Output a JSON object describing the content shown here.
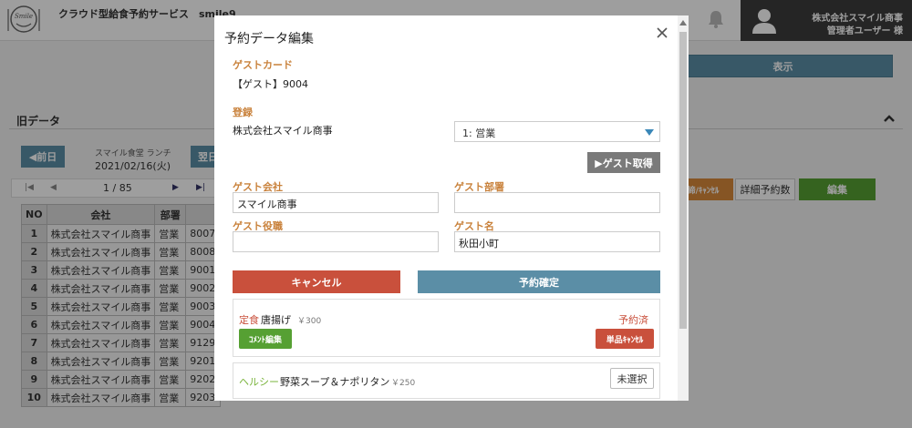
{
  "header": {
    "app_title": "クラウド型給食予約サービス　smile9",
    "user_company": "株式会社スマイル商事",
    "user_role": "管理者ユーザー 様"
  },
  "background": {
    "show_button": "表示",
    "section_title": "旧データ",
    "prev_button": "◀前日",
    "meal_name": "スマイル食堂 ランチ",
    "meal_date": "2021/02/16(火)",
    "next_button": "翌日",
    "pager_text": "1 / 85",
    "cancel_header_button": "締/ｷｬﾝｾﾙ",
    "detail_button": "詳細予約数",
    "edit_button": "編集",
    "table": {
      "headers": [
        "NO",
        "会社",
        "部署",
        ""
      ],
      "rows": [
        [
          "1",
          "株式会社スマイル商事",
          "営業",
          "8007"
        ],
        [
          "2",
          "株式会社スマイル商事",
          "営業",
          "8008"
        ],
        [
          "3",
          "株式会社スマイル商事",
          "営業",
          "9001"
        ],
        [
          "4",
          "株式会社スマイル商事",
          "営業",
          "9002"
        ],
        [
          "5",
          "株式会社スマイル商事",
          "営業",
          "9003"
        ],
        [
          "6",
          "株式会社スマイル商事",
          "営業",
          "9004"
        ],
        [
          "7",
          "株式会社スマイル商事",
          "営業",
          "9129"
        ],
        [
          "8",
          "株式会社スマイル商事",
          "営業",
          "9201"
        ],
        [
          "9",
          "株式会社スマイル商事",
          "営業",
          "9202"
        ],
        [
          "10",
          "株式会社スマイル商事",
          "営業",
          "9203"
        ]
      ]
    }
  },
  "modal": {
    "title": "予約データ編集",
    "guest_card_label": "ゲストカード",
    "guest_card_value": "【ゲスト】9004",
    "register_label": "登録",
    "register_company": "株式会社スマイル商事",
    "department_select": "1: 営業",
    "guest_get_button": "▶ゲスト取得",
    "guest_company_label": "ゲスト会社",
    "guest_company_value": "スマイル商事",
    "guest_dept_label": "ゲスト部署",
    "guest_dept_value": "",
    "guest_position_label": "ゲスト役職",
    "guest_position_value": "",
    "guest_name_label": "ゲスト名",
    "guest_name_value": "秋田小町",
    "cancel_button": "キャンセル",
    "confirm_button": "予約確定",
    "menus": [
      {
        "category": "定食",
        "category_color": "#c9503c",
        "name": "唐揚げ",
        "price": "￥300",
        "status": "予約済",
        "comment_button": "ｺﾒﾝﾄ編集",
        "cancel_button": "単品ｷｬﾝｾﾙ"
      },
      {
        "category": "ヘルシー",
        "category_color": "#7ab43c",
        "name": "野菜スープ＆ナポリタン",
        "price": "￥250",
        "select_button": "未選択"
      }
    ]
  },
  "colors": {
    "label_orange": "#c9823c",
    "primary_blue": "#5b8ea6",
    "danger_red": "#c9503c",
    "success_green": "#56a033",
    "gray_button": "#7a7a7a"
  },
  "icons": [
    "smile-logo-icon",
    "bell-icon",
    "user-avatar-icon",
    "close-icon",
    "chevron-down-icon",
    "chevron-up-icon",
    "first-page-icon",
    "prev-page-icon",
    "next-page-icon",
    "last-page-icon"
  ]
}
